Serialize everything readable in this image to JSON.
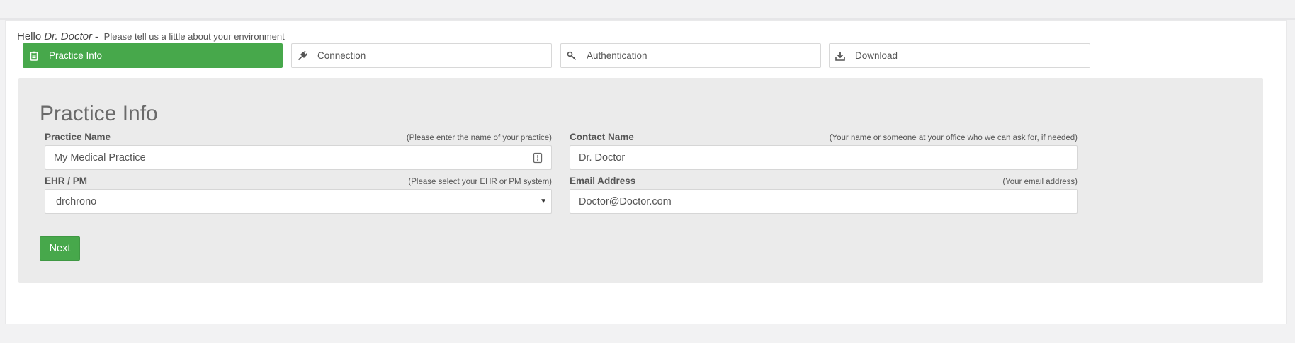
{
  "greeting": {
    "hello": "Hello",
    "name": "Dr. Doctor",
    "dash": "-",
    "subtitle": "Please tell us a little about your environment"
  },
  "steps": [
    {
      "label": "Practice Info",
      "icon": "clipboard-icon",
      "active": true
    },
    {
      "label": "Connection",
      "icon": "plug-icon",
      "active": false
    },
    {
      "label": "Authentication",
      "icon": "key-icon",
      "active": false
    },
    {
      "label": "Download",
      "icon": "download-icon",
      "active": false
    }
  ],
  "form": {
    "title": "Practice Info",
    "practice_name": {
      "label": "Practice Name",
      "hint": "(Please enter the name of your practice)",
      "value": "My Medical Practice"
    },
    "contact_name": {
      "label": "Contact Name",
      "hint": "(Your name or someone at your office who we can ask for, if needed)",
      "value": "Dr. Doctor"
    },
    "ehr_pm": {
      "label": "EHR / PM",
      "hint": "(Please select your EHR or PM system)",
      "value": "drchrono"
    },
    "email": {
      "label": "Email Address",
      "hint": "(Your email address)",
      "value": "Doctor@Doctor.com"
    },
    "next_label": "Next"
  },
  "colors": {
    "accent": "#47a84b",
    "form_bg": "#ebebeb",
    "page_bg": "#f2f2f3"
  }
}
